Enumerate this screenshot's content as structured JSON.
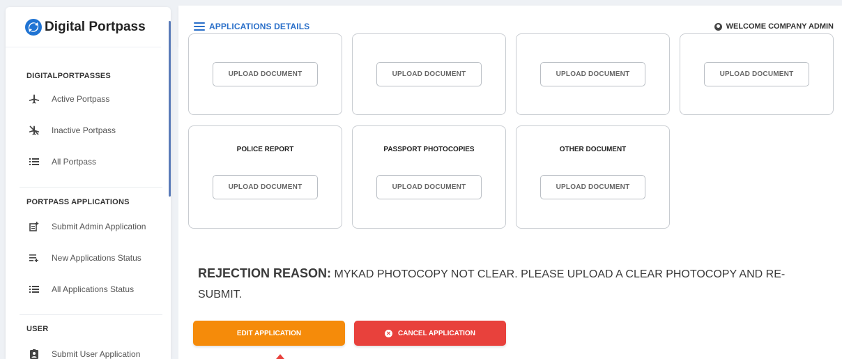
{
  "sidebar": {
    "brand": "Digital Portpass",
    "sections": [
      {
        "title": "DIGITALPORTPASSES"
      },
      {
        "title": "PORTPASS APPLICATIONS"
      },
      {
        "title": "USER"
      }
    ],
    "items": [
      {
        "label": "Active Portpass",
        "icon": "airplane-icon"
      },
      {
        "label": "Inactive Portpass",
        "icon": "airplane-off-icon"
      },
      {
        "label": "All Portpass",
        "icon": "list-icon"
      },
      {
        "label": "Submit Admin Application",
        "icon": "add-note-icon"
      },
      {
        "label": "New Applications Status",
        "icon": "list-add-icon"
      },
      {
        "label": "All Applications Status",
        "icon": "list-icon"
      },
      {
        "label": "Submit User Application",
        "icon": "badge-icon"
      }
    ]
  },
  "header": {
    "title": "APPLICATIONS DETAILS",
    "welcome": "WELCOME COMPANY ADMIN"
  },
  "documents": {
    "top_row": [
      {
        "upload_label": "UPLOAD DOCUMENT"
      },
      {
        "upload_label": "UPLOAD DOCUMENT"
      },
      {
        "upload_label": "UPLOAD DOCUMENT"
      },
      {
        "upload_label": "UPLOAD DOCUMENT"
      }
    ],
    "second_row": [
      {
        "title": "POLICE REPORT",
        "upload_label": "UPLOAD DOCUMENT"
      },
      {
        "title": "PASSPORT PHOTOCOPIES",
        "upload_label": "UPLOAD DOCUMENT"
      },
      {
        "title": "OTHER DOCUMENT",
        "upload_label": "UPLOAD DOCUMENT"
      }
    ]
  },
  "rejection": {
    "label": "REJECTION REASON:",
    "text": "MYKAD PHOTOCOPY NOT CLEAR. PLEASE UPLOAD A CLEAR PHOTOCOPY AND RE-SUBMIT."
  },
  "actions": {
    "edit_label": "EDIT APPLICATION",
    "cancel_label": "CANCEL APPLICATION"
  },
  "colors": {
    "accent": "#2a6fc9",
    "edit": "#f58b0a",
    "cancel": "#e8413c"
  }
}
